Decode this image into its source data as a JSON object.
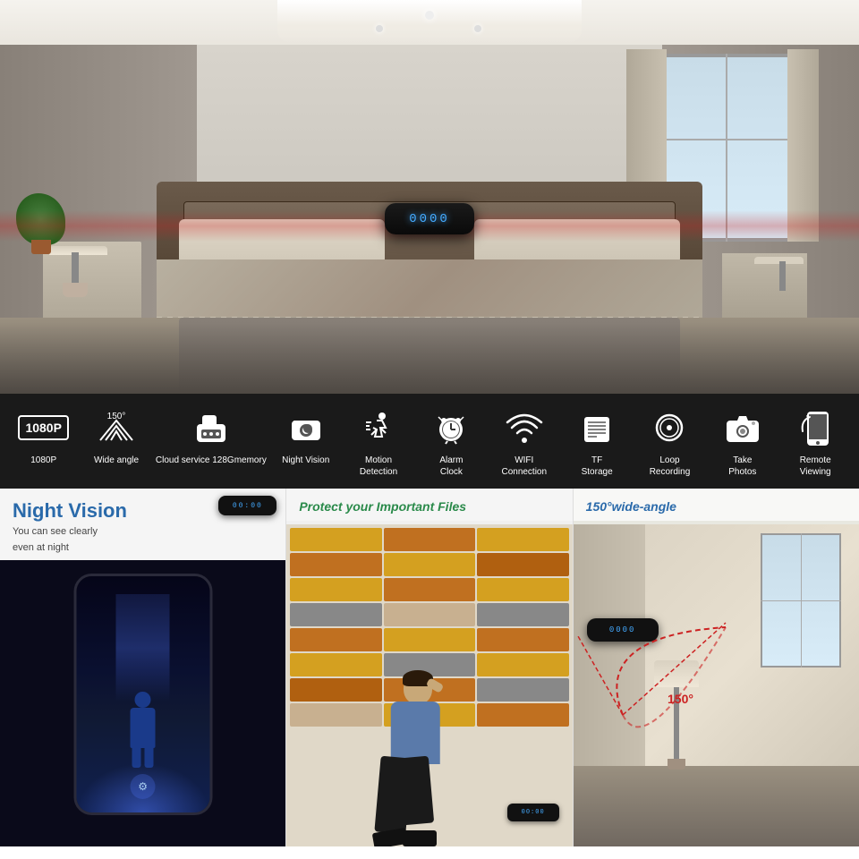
{
  "hero": {
    "device_display": "0000",
    "alt": "Hidden Camera Alarm Clock in bedroom"
  },
  "features": {
    "items": [
      {
        "id": "f1080p",
        "icon": "1080p",
        "label": "1080P"
      },
      {
        "id": "wide-angle",
        "icon": "wifi-signal",
        "label": "Wide\nangle"
      },
      {
        "id": "cloud",
        "icon": "cloud-storage",
        "label": "Cloud service\n128Gmemory"
      },
      {
        "id": "night-vision",
        "icon": "night-vision",
        "label": "Night\nVision"
      },
      {
        "id": "motion",
        "icon": "motion",
        "label": "Motion\nDetection"
      },
      {
        "id": "alarm",
        "icon": "alarm",
        "label": "Alarm\nClock"
      },
      {
        "id": "wifi",
        "icon": "wifi",
        "label": "WIFI\nConnection"
      },
      {
        "id": "tf",
        "icon": "sd-card",
        "label": "TF\nStorage"
      },
      {
        "id": "loop",
        "icon": "loop",
        "label": "Loop\nRecording"
      },
      {
        "id": "photo",
        "icon": "camera",
        "label": "Take\nPhotos"
      },
      {
        "id": "remote",
        "icon": "phone",
        "label": "Remote\nViewing"
      }
    ]
  },
  "panels": {
    "night_vision": {
      "title": "Night Vision",
      "subtitle": "You can see clearly\neven at night",
      "device_display": "00:00"
    },
    "important_files": {
      "title": "Protect your Important Files",
      "device_display": "00:00"
    },
    "wide_angle": {
      "title": "150°wide-angle",
      "angle_label": "150°",
      "device_display": "0000"
    }
  }
}
